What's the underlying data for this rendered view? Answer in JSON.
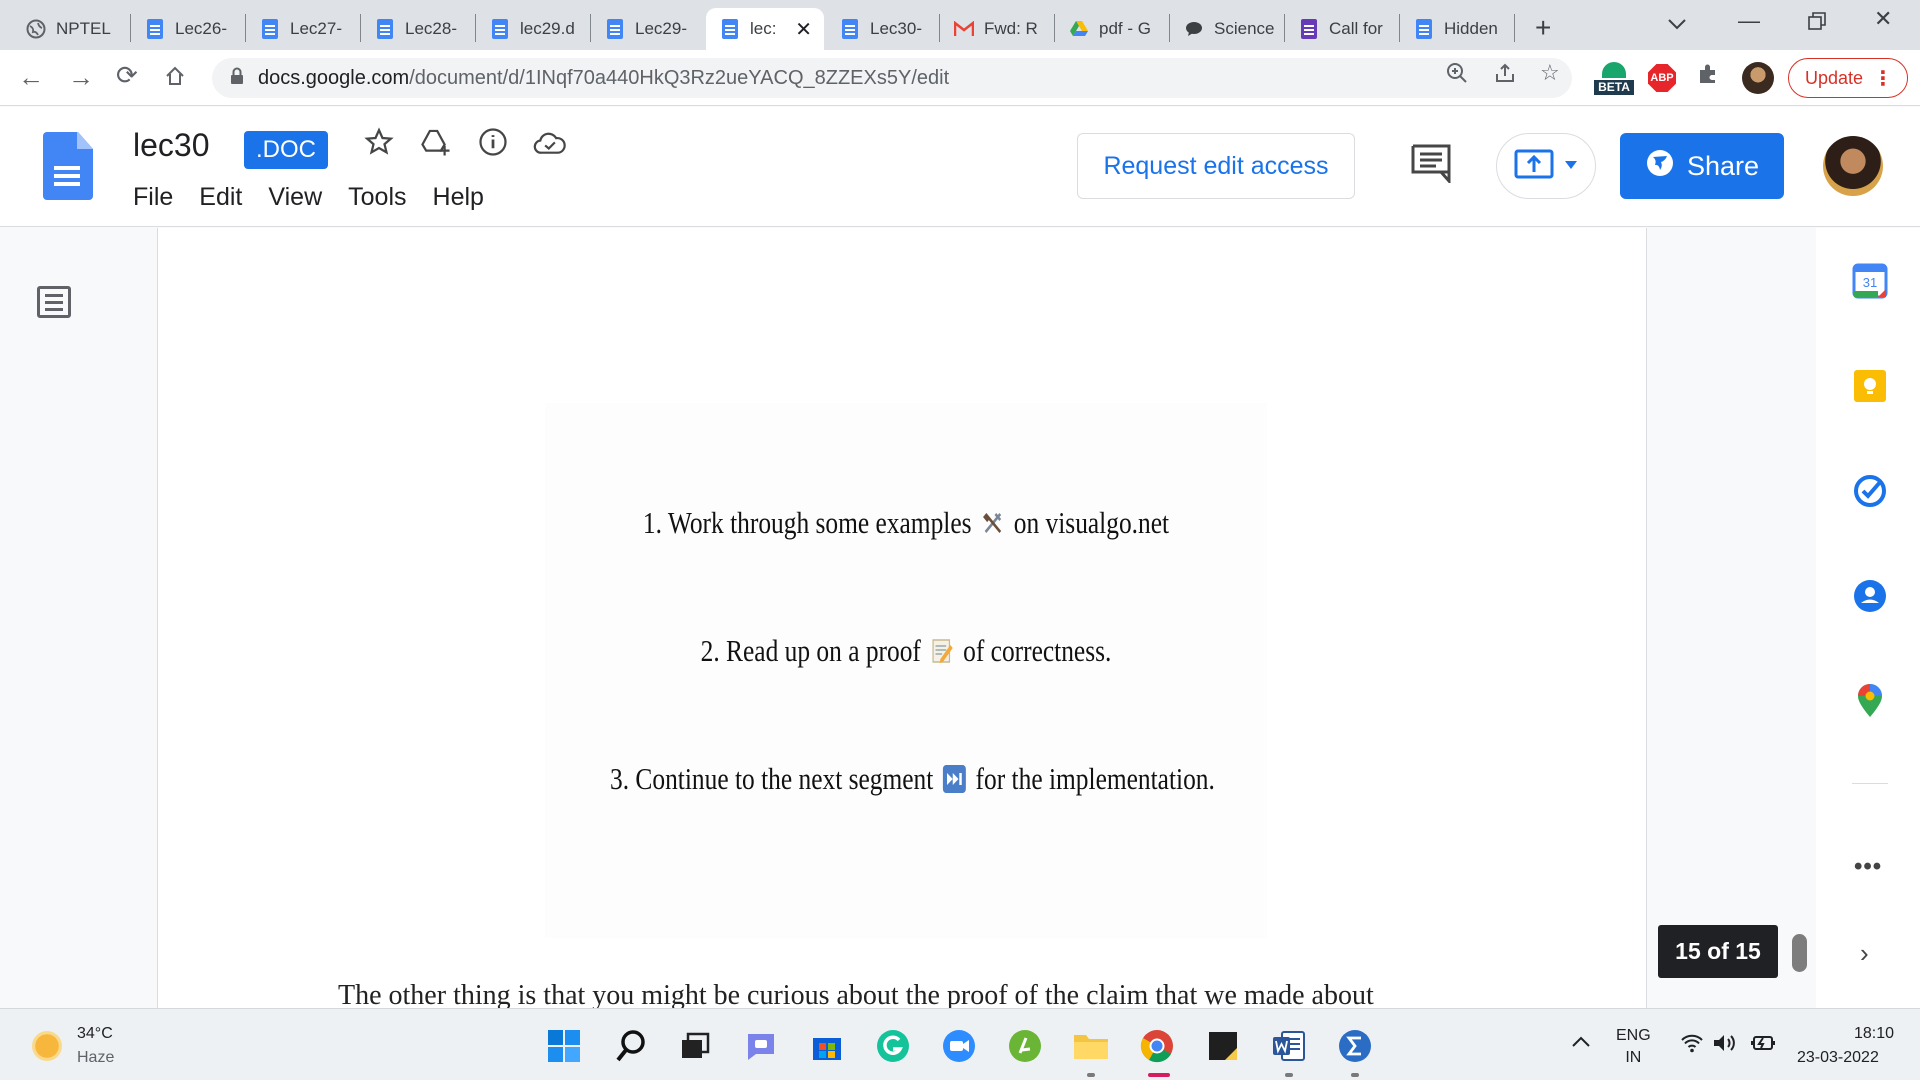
{
  "browser": {
    "tabs": [
      {
        "title": "NPTEL",
        "icon": "globe-icon",
        "active": false
      },
      {
        "title": "Lec26-",
        "icon": "google-docs-icon",
        "active": false
      },
      {
        "title": "Lec27-",
        "icon": "google-docs-icon",
        "active": false
      },
      {
        "title": "Lec28-",
        "icon": "google-docs-icon",
        "active": false
      },
      {
        "title": "lec29.d",
        "icon": "google-docs-icon",
        "active": false
      },
      {
        "title": "Lec29-",
        "icon": "google-docs-icon",
        "active": false
      },
      {
        "title": "lec:",
        "icon": "google-docs-icon",
        "active": true
      },
      {
        "title": "Lec30-",
        "icon": "google-docs-icon",
        "active": false
      },
      {
        "title": "Fwd: R",
        "icon": "gmail-icon",
        "active": false
      },
      {
        "title": "pdf - G",
        "icon": "google-drive-icon",
        "active": false
      },
      {
        "title": "Science",
        "icon": "chat-icon",
        "active": false
      },
      {
        "title": "Call for",
        "icon": "google-forms-icon",
        "active": false
      },
      {
        "title": "Hidden",
        "icon": "google-docs-icon",
        "active": false
      }
    ],
    "url_domain": "docs.google.com",
    "url_path": "/document/d/1INqf70a440HkQ3Rz2ueYACQ_8ZZEXs5Y/edit",
    "extension_beta_label": "BETA",
    "abp_label": "ABP",
    "update_label": "Update"
  },
  "docs": {
    "title": "lec30",
    "badge": ".DOC",
    "menus": [
      "File",
      "Edit",
      "View",
      "Tools",
      "Help"
    ],
    "request_edit_label": "Request edit access",
    "share_label": "Share"
  },
  "document": {
    "slide_lines": [
      {
        "before": "1. Work through some examples",
        "icon": "tools-emoji-icon",
        "after": "on visualgo.net"
      },
      {
        "before": "2. Read up on a proof",
        "icon": "memo-emoji-icon",
        "after": "of correctness."
      },
      {
        "before": "3. Continue to the next segment",
        "icon": "fast-forward-emoji-icon",
        "after": "for the implementation."
      }
    ],
    "paragraph": "The other thing is that you might be curious about the proof of the claim that we made about",
    "page_counter": "15 of 15"
  },
  "side_panel": {
    "apps": [
      "calendar-icon",
      "keep-icon",
      "tasks-icon",
      "contacts-icon",
      "maps-icon"
    ],
    "calendar_day": "31",
    "more_label": "•••"
  },
  "taskbar": {
    "weather_temp": "34°C",
    "weather_desc": "Haze",
    "language_line1": "ENG",
    "language_line2": "IN",
    "time": "18:10",
    "date": "23-03-2022"
  },
  "colors": {
    "accent": "#1a73e8",
    "update_red": "#d93025",
    "tab_strip": "#dee1e6"
  }
}
